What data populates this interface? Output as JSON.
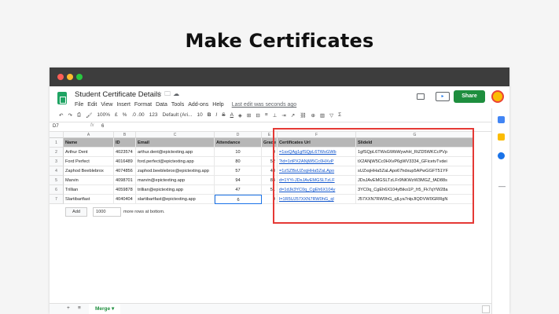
{
  "headline": "Make Certificates",
  "colors": {
    "accent_green": "#1e8e3e",
    "link_blue": "#1155cc",
    "highlight_red": "#e53935",
    "header_gray": "#b7b7b7"
  },
  "window": {
    "dots": [
      "#ff5f57",
      "#febc2e",
      "#28c840"
    ]
  },
  "app": {
    "doc_title": "Student Certificate Details",
    "title_icons": [
      "star-icon",
      "folder-icon",
      "cloud-icon"
    ],
    "menu": [
      "File",
      "Edit",
      "View",
      "Insert",
      "Format",
      "Data",
      "Tools",
      "Add-ons",
      "Help"
    ],
    "last_edit": "Last edit was seconds ago",
    "share_label": "Share"
  },
  "toolbar": {
    "zoom": "100%",
    "currency": "£",
    "percent": "%",
    "decimals": ".0 .00",
    "format": "123",
    "font": "Default (Ari...",
    "font_size": "10",
    "bold": "B",
    "italic": "I",
    "strike": "S",
    "text_color": "A"
  },
  "formula": {
    "cell_ref": "D7",
    "fx": "fx",
    "value": "6"
  },
  "grid": {
    "columns": [
      "A",
      "B",
      "C",
      "D",
      "E",
      "F",
      "G"
    ],
    "rows": [
      "1",
      "2",
      "3",
      "4",
      "5",
      "6",
      "7"
    ],
    "header": [
      "Name",
      "ID",
      "Email",
      "Attendance",
      "Grade",
      "Certificates Url",
      "SlideId"
    ],
    "data": [
      [
        "Arthur Dent",
        "4023574",
        "arthur.dent@epictexting.app",
        "10",
        "0",
        "=1sxQAg1gfSQpL6TWsGWb",
        "1gfSQpL6TWsGWbWywhH_RiZD5WKCcPVp"
      ],
      [
        "Ford Perfect",
        "4016489",
        "ford.perfect@epictexting.app",
        "80",
        "52",
        "?id=1rtPX2ANjW5Cc0HXvP",
        "tX2ANjW5Cc0HXvP6gWV3334_GFicetvTvdei"
      ],
      [
        "Zaphod Beeblebrox",
        "4074856",
        "zaphod.beeblebrox@epictexting.app",
        "57",
        "48",
        "=1zSZBsUZxqHHa5ZaLApo",
        "sUZxqHHa5ZaLApo67hdxup5APwGGFT51YF"
      ],
      [
        "Marvin",
        "4098701",
        "marvin@epictexting.app",
        "94",
        "84",
        "d=1YYi-JDsJAvEMGSLTzLF",
        "JDsJAvEMGSLTzLFr9NKWzW3MGZ_fAD88s"
      ],
      [
        "Trillian",
        "4059878",
        "trillian@epictexting.app",
        "47",
        "51",
        "d=1dJk3YC0q_CgEh6X104y",
        "3YC0q_CgEh6X104yBiko1P_fr5_Fk7qYW28a"
      ],
      [
        "Slartibartfast",
        "4040404",
        "slartibartfast@epictexting.app",
        "6",
        "0",
        "l=1R5UJ57XXN7RW0hG_ql",
        "J57XXN7RW0hG_qlLya7nlpJlQDVW0GRRgN"
      ]
    ]
  },
  "add_rows": {
    "button": "Add",
    "count": "1000",
    "suffix": "more rows at bottom."
  },
  "sheet_tabs": {
    "plus": "+",
    "list": "≡",
    "active": "Merge ▾"
  }
}
